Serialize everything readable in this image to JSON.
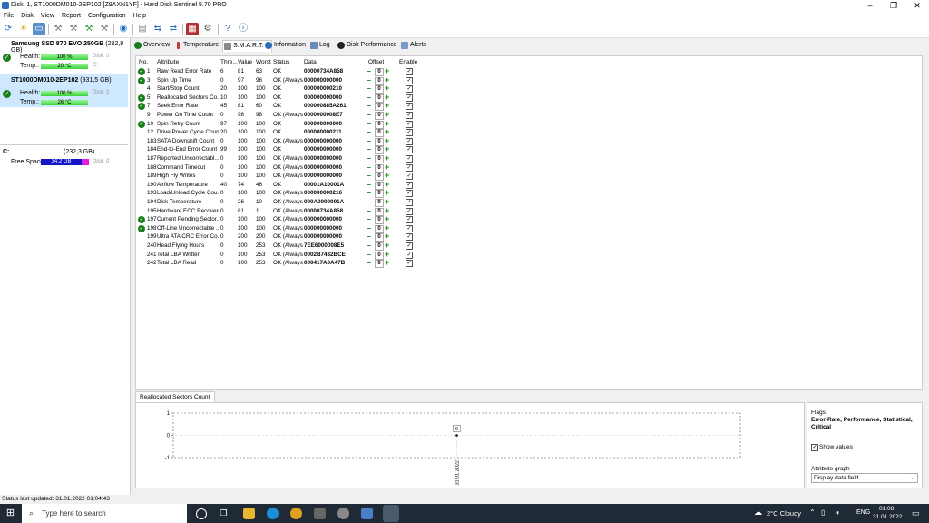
{
  "window": {
    "title": "Disk: 1, ST1000DM010-2EP102 [Z9AXN1YF] - Hard Disk Sentinel 5.70 PRO"
  },
  "menu": [
    "File",
    "Disk",
    "View",
    "Report",
    "Configuration",
    "Help"
  ],
  "disks": [
    {
      "name": "Samsung SSD 870 EVO 250GB",
      "size": "(232,9 GB)",
      "health_label": "Health:",
      "health": "100 %",
      "health_value": 100,
      "disk_label": "Disk: 0",
      "temp_label": "Temp.:",
      "temp": "20 °C",
      "drive": "C:"
    },
    {
      "name": "ST1000DM010-2EP102",
      "size": "(931,5 GB)",
      "health_label": "Health:",
      "health": "100 %",
      "health_value": 100,
      "disk_label": "Disk: 1",
      "temp_label": "Temp.:",
      "temp": "26 °C",
      "drive": ""
    }
  ],
  "volume": {
    "letter": "C:",
    "size": "(232,3 GB)",
    "free_label": "Free Space",
    "free": "34,2 GB",
    "disk_label": "Disk: 0"
  },
  "tabs": [
    "Overview",
    "Temperature",
    "S.M.A.R.T.",
    "Information",
    "Log",
    "Disk Performance",
    "Alerts"
  ],
  "active_tab": "S.M.A.R.T.",
  "smart": {
    "headers": {
      "no": "No.",
      "attr": "Attribute",
      "thre": "Thre...",
      "value": "Value",
      "worst": "Worst",
      "status": "Status",
      "data": "Data",
      "offset": "Offset",
      "enable": "Enable"
    },
    "rows": [
      {
        "ok": true,
        "no": "1",
        "attr": "Raw Read Error Rate",
        "thre": "6",
        "value": "81",
        "worst": "63",
        "status": "OK",
        "data": "00000734A858",
        "offset": "0"
      },
      {
        "ok": true,
        "no": "3",
        "attr": "Spin Up Time",
        "thre": "0",
        "value": "97",
        "worst": "96",
        "status": "OK (Always...",
        "data": "000000000000",
        "offset": "0"
      },
      {
        "ok": false,
        "no": "4",
        "attr": "Start/Stop Count",
        "thre": "20",
        "value": "100",
        "worst": "100",
        "status": "OK",
        "data": "000000000210",
        "offset": "0"
      },
      {
        "ok": true,
        "no": "5",
        "attr": "Reallocated Sectors Co...",
        "thre": "10",
        "value": "100",
        "worst": "100",
        "status": "OK",
        "data": "000000000000",
        "offset": "0"
      },
      {
        "ok": true,
        "no": "7",
        "attr": "Seek Error Rate",
        "thre": "45",
        "value": "81",
        "worst": "60",
        "status": "OK",
        "data": "000000885A261",
        "offset": "0"
      },
      {
        "ok": false,
        "no": "9",
        "attr": "Power On Time Count",
        "thre": "0",
        "value": "98",
        "worst": "98",
        "status": "OK (Always...",
        "data": "0000000008E7",
        "offset": "0"
      },
      {
        "ok": true,
        "no": "10",
        "attr": "Spin Retry Count",
        "thre": "97",
        "value": "100",
        "worst": "100",
        "status": "OK",
        "data": "000000000000",
        "offset": "0"
      },
      {
        "ok": false,
        "no": "12",
        "attr": "Drive Power Cycle Count",
        "thre": "20",
        "value": "100",
        "worst": "100",
        "status": "OK",
        "data": "000000000211",
        "offset": "0"
      },
      {
        "ok": false,
        "no": "183",
        "attr": "SATA Downshift Count",
        "thre": "0",
        "value": "100",
        "worst": "100",
        "status": "OK (Always...",
        "data": "000000000000",
        "offset": "0"
      },
      {
        "ok": false,
        "no": "184",
        "attr": "End-to-End Error Count",
        "thre": "99",
        "value": "100",
        "worst": "100",
        "status": "OK",
        "data": "000000000000",
        "offset": "0"
      },
      {
        "ok": false,
        "no": "187",
        "attr": "Reported Uncorrectabl...",
        "thre": "0",
        "value": "100",
        "worst": "100",
        "status": "OK (Always...",
        "data": "000000000000",
        "offset": "0"
      },
      {
        "ok": false,
        "no": "188",
        "attr": "Command Timeout",
        "thre": "0",
        "value": "100",
        "worst": "100",
        "status": "OK (Always...",
        "data": "000000000000",
        "offset": "0"
      },
      {
        "ok": false,
        "no": "189",
        "attr": "High Fly Writes",
        "thre": "0",
        "value": "100",
        "worst": "100",
        "status": "OK (Always...",
        "data": "000000000000",
        "offset": "0"
      },
      {
        "ok": false,
        "no": "190",
        "attr": "Airflow Temperature",
        "thre": "40",
        "value": "74",
        "worst": "46",
        "status": "OK",
        "data": "00001A10001A",
        "offset": "0"
      },
      {
        "ok": false,
        "no": "193",
        "attr": "Load/Unload Cycle Cou...",
        "thre": "0",
        "value": "100",
        "worst": "100",
        "status": "OK (Always...",
        "data": "000000000216",
        "offset": "0"
      },
      {
        "ok": false,
        "no": "194",
        "attr": "Disk Temperature",
        "thre": "0",
        "value": "26",
        "worst": "10",
        "status": "OK (Always...",
        "data": "000A0000001A",
        "offset": "0"
      },
      {
        "ok": false,
        "no": "195",
        "attr": "Hardware ECC Recovered",
        "thre": "0",
        "value": "81",
        "worst": "1",
        "status": "OK (Always...",
        "data": "00000734A858",
        "offset": "0"
      },
      {
        "ok": true,
        "no": "197",
        "attr": "Current Pending Sector...",
        "thre": "0",
        "value": "100",
        "worst": "100",
        "status": "OK (Always...",
        "data": "000000000000",
        "offset": "0"
      },
      {
        "ok": true,
        "no": "198",
        "attr": "Off-Line Uncorrectable ...",
        "thre": "0",
        "value": "100",
        "worst": "100",
        "status": "OK (Always...",
        "data": "000000000000",
        "offset": "0"
      },
      {
        "ok": false,
        "no": "199",
        "attr": "Ultra ATA CRC Error Co...",
        "thre": "0",
        "value": "200",
        "worst": "200",
        "status": "OK (Always...",
        "data": "000000000000",
        "offset": "0"
      },
      {
        "ok": false,
        "no": "240",
        "attr": "Head Flying Hours",
        "thre": "0",
        "value": "100",
        "worst": "253",
        "status": "OK (Always...",
        "data": "7EE6000008E5",
        "offset": "0"
      },
      {
        "ok": false,
        "no": "241",
        "attr": "Total LBA Written",
        "thre": "0",
        "value": "100",
        "worst": "253",
        "status": "OK (Always...",
        "data": "0002B7432BCE",
        "offset": "0"
      },
      {
        "ok": false,
        "no": "242",
        "attr": "Total LBA Read",
        "thre": "0",
        "value": "100",
        "worst": "253",
        "status": "OK (Always...",
        "data": "000417A0A47B",
        "offset": "0"
      }
    ]
  },
  "graph": {
    "tab_label": "Reallocated Sectors Count",
    "y_ticks": [
      "1",
      "0",
      "-1"
    ],
    "point_label": "0",
    "x_label": "31.01.2022"
  },
  "chart_data": {
    "type": "line",
    "title": "",
    "xlabel": "",
    "ylabel": "",
    "x": [
      "31.01.2022"
    ],
    "series": [
      {
        "values": [
          0
        ]
      }
    ],
    "ylim": [
      -1,
      1
    ],
    "grid": true
  },
  "flags": {
    "label": "Flags",
    "value": "Error-Rate, Performance, Statistical, Critical",
    "show_values_label": "Show values",
    "attr_graph_label": "Attribute graph",
    "attr_graph_value": "Display data field"
  },
  "status_bar": "Status last updated: 31.01.2022 01:04:43",
  "taskbar": {
    "search_placeholder": "Type here to search",
    "weather": "2°C  Cloudy",
    "lang": "ENG",
    "time": "01:08",
    "date": "31.01.2022"
  },
  "colors": {
    "ok_green": "#1a7f1a",
    "health_bar": "#3ad33a",
    "free_bar_blue": "#1515c8",
    "free_bar_pink": "#e21ce0",
    "accent": "#1a6fd0"
  },
  "icons": [
    "refresh-icon",
    "sun-icon",
    "screen-icon",
    "wrench-icon",
    "globe-icon",
    "report-icon",
    "network-icon",
    "settings-icon",
    "help-icon",
    "info-icon"
  ]
}
